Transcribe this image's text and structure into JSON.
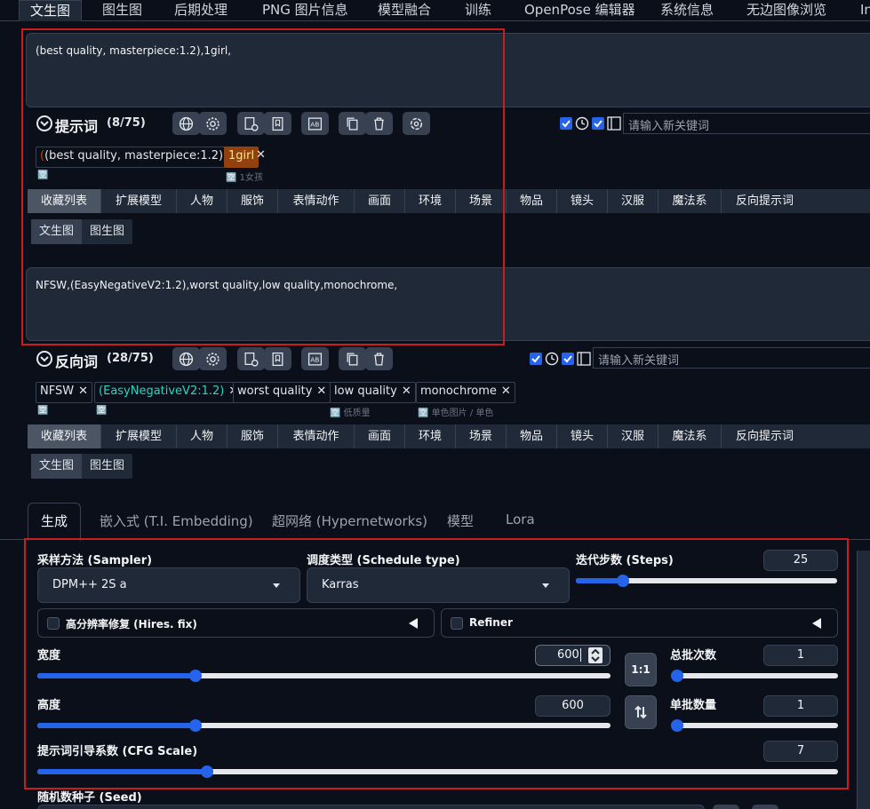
{
  "top_tabs": [
    "文生图",
    "图生图",
    "后期处理",
    "PNG 图片信息",
    "模型融合",
    "训练",
    "OpenPose 编辑器",
    "系统信息",
    "无边图像浏览",
    "In"
  ],
  "prompt": {
    "text": "(best quality, masterpiece:1.2),1girl,",
    "label": "提示词",
    "count": "(8/75)",
    "keyword_placeholder": "请输入新关键词",
    "tags": [
      {
        "text": "(best quality, masterpiece:1.2)",
        "sub": "",
        "color": "#e5e7eb"
      },
      {
        "text": "1girl",
        "sub": "1女孩",
        "color": "#fde68a"
      }
    ]
  },
  "negative": {
    "text": "NFSW,(EasyNegativeV2:1.2),worst quality,low quality,monochrome,",
    "label": "反向词",
    "count": "(28/75)",
    "keyword_placeholder": "请输入新关键词",
    "tags": [
      {
        "text": "NFSW",
        "sub": ""
      },
      {
        "text": "(EasyNegativeV2:1.2)",
        "sub": ""
      },
      {
        "text": "worst quality",
        "sub": ""
      },
      {
        "text": "low quality",
        "sub": "低质量"
      },
      {
        "text": "monochrome",
        "sub": "单色图片 / 单色"
      }
    ]
  },
  "categories": [
    "收藏列表",
    "扩展模型",
    "人物",
    "服饰",
    "表情动作",
    "画面",
    "环境",
    "场景",
    "物品",
    "镜头",
    "汉服",
    "魔法系",
    "反向提示词"
  ],
  "subtabs": [
    "文生图",
    "图生图"
  ],
  "gen_tabs": [
    "生成",
    "嵌入式 (T.I. Embedding)",
    "超网络 (Hypernetworks)",
    "模型",
    "Lora"
  ],
  "settings": {
    "sampler_label": "采样方法 (Sampler)",
    "sampler_value": "DPM++ 2S a",
    "schedule_label": "调度类型 (Schedule type)",
    "schedule_value": "Karras",
    "steps_label": "迭代步数 (Steps)",
    "steps_value": "25",
    "hires_label": "高分辨率修复 (Hires. fix)",
    "refiner_label": "Refiner",
    "width_label": "宽度",
    "width_value": "600",
    "height_label": "高度",
    "height_value": "600",
    "ratio_label": "1:1",
    "batch_count_label": "总批次数",
    "batch_count_value": "1",
    "batch_size_label": "单批数量",
    "batch_size_value": "1",
    "cfg_label": "提示词引导系数 (CFG Scale)",
    "cfg_value": "7",
    "seed_label": "随机数种子 (Seed)"
  },
  "colors": {
    "accent": "#2563eb",
    "highlight_box": "#c81e1e",
    "bg": "#0b0f19"
  }
}
